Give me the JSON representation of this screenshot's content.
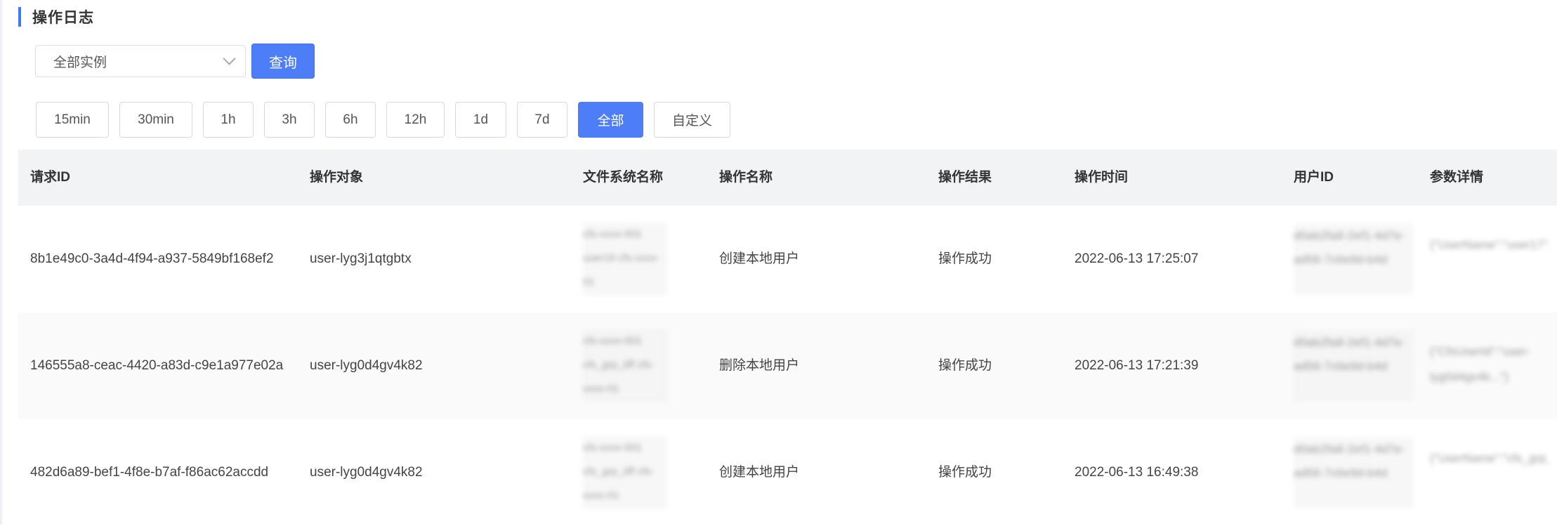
{
  "page": {
    "title": "操作日志"
  },
  "filter": {
    "instance_select": "全部实例",
    "query_label": "查询"
  },
  "time_ranges": [
    {
      "label": "15min",
      "active": false
    },
    {
      "label": "30min",
      "active": false
    },
    {
      "label": "1h",
      "active": false
    },
    {
      "label": "3h",
      "active": false
    },
    {
      "label": "6h",
      "active": false
    },
    {
      "label": "12h",
      "active": false
    },
    {
      "label": "1d",
      "active": false
    },
    {
      "label": "7d",
      "active": false
    },
    {
      "label": "全部",
      "active": true
    },
    {
      "label": "自定义",
      "active": false
    }
  ],
  "table": {
    "columns": [
      "请求ID",
      "操作对象",
      "文件系统名称",
      "操作名称",
      "操作结果",
      "操作时间",
      "用户ID",
      "参数详情"
    ],
    "rows": [
      {
        "request_id": "8b1e49c0-3a4d-4f94-a937-5849bf168ef2",
        "target": "user-lyg3j1qtgbtx",
        "filesystem": "cfs-xxxx-001 user19 cfs-xxxx-01",
        "action": "创建本地用户",
        "result": "操作成功",
        "time": "2022-06-13 17:25:07",
        "user_id": "d0ab2fa8-2ef1-4d7e-ad56-7c6e9d-b4d",
        "params": "{\"UserName\":\"user17\",\"UserId\":..."
      },
      {
        "request_id": "146555a8-ceac-4420-a83d-c9e1a977e02a",
        "target": "user-lyg0d4gv4k82",
        "filesystem": "cfs-xxxx-001 cfs_grp_tiff cfs-xxxx-01",
        "action": "删除本地用户",
        "result": "操作成功",
        "time": "2022-06-13 17:21:39",
        "user_id": "d0ab2fa8-2ef1-4d7e-ad56-7c6e9d-b4d",
        "params": "{\"CfsUserId\":\"user-lyg0d4gv4k...\"}"
      },
      {
        "request_id": "482d6a89-bef1-4f8e-b7af-f86ac62accdd",
        "target": "user-lyg0d4gv4k82",
        "filesystem": "cfs-xxxx-001 cfs_grp_tiff cfs-xxxx-01",
        "action": "创建本地用户",
        "result": "操作成功",
        "time": "2022-06-13 16:49:38",
        "user_id": "d0ab2fa8-2ef1-4d7e-ad56-7c6e9d-b4d",
        "params": "{\"UserName\":\"cfs_grp_tiff\",\"Usert..."
      }
    ]
  }
}
